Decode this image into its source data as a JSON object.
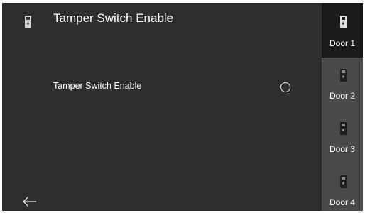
{
  "header": {
    "icon": "door-intercom-icon",
    "title": "Tamper Switch Enable"
  },
  "setting": {
    "label": "Tamper Switch Enable",
    "enabled": false
  },
  "footer": {
    "back_icon": "back-arrow-icon"
  },
  "side_nav": {
    "tabs": [
      {
        "label": "Door 1",
        "icon": "door-intercom-icon",
        "active": true
      },
      {
        "label": "Door 2",
        "icon": "door-intercom-icon",
        "active": false
      },
      {
        "label": "Door 3",
        "icon": "door-intercom-icon",
        "active": false
      },
      {
        "label": "Door 4",
        "icon": "door-intercom-icon",
        "active": false
      }
    ]
  },
  "colors": {
    "background": "#2e2e2e",
    "side_nav_background": "#4a4a4a",
    "active_tab_background": "#1b1b1b",
    "text": "#ffffff"
  }
}
